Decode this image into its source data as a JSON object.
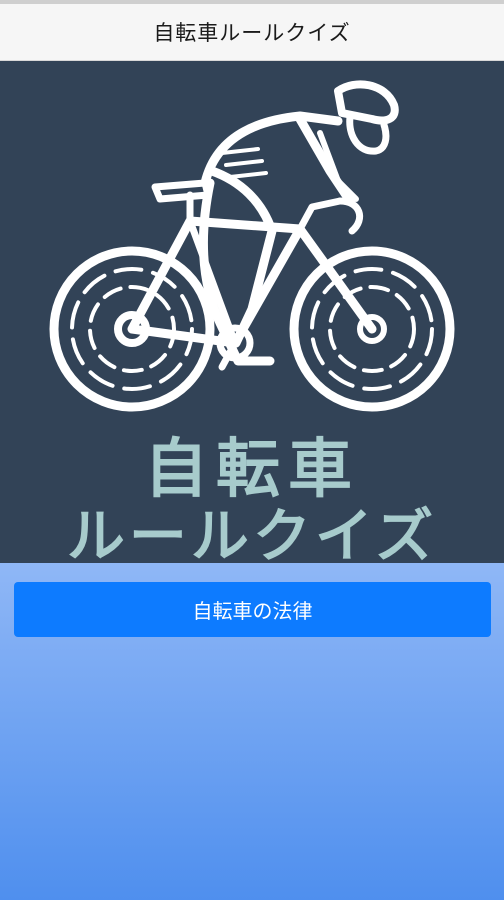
{
  "header": {
    "title": "自転車ルールクイズ"
  },
  "hero": {
    "logo_line1": "自転車",
    "logo_line2": "ルールクイズ",
    "logo_icon": "cyclist-icon"
  },
  "menu": {
    "items": [
      {
        "label": "自転車の法律"
      }
    ]
  },
  "colors": {
    "header_bg": "#f6f6f6",
    "hero_bg": "#324357",
    "logo_text": "#a7cbcc",
    "button_bg": "#0d7bff",
    "content_gradient_top": "#8fb7f6",
    "content_gradient_bottom": "#4f8fee"
  }
}
